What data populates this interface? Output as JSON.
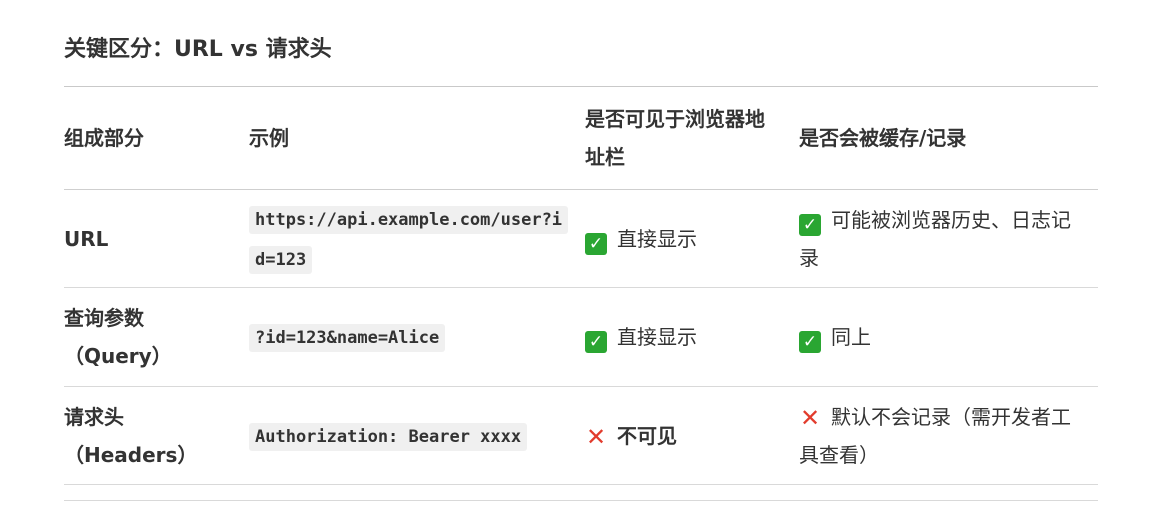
{
  "heading": "关键区分：URL vs 请求头",
  "columns": [
    "组成部分",
    "示例",
    "是否可见于浏览器地址栏",
    "是否会被缓存/记录"
  ],
  "rows": [
    {
      "part": "URL",
      "example": "https://api.example.com/user?id=123",
      "visible": {
        "icon": "check-icon",
        "text": "直接显示"
      },
      "cached": {
        "icon": "check-icon",
        "text": "可能被浏览器历史、日志记录"
      }
    },
    {
      "part": "查询参数\n（Query）",
      "example": "?id=123&name=Alice",
      "visible": {
        "icon": "check-icon",
        "text": "直接显示"
      },
      "cached": {
        "icon": "check-icon",
        "text": "同上"
      }
    },
    {
      "part": "请求头\n（Headers）",
      "example": "Authorization: Bearer xxxx",
      "visible": {
        "icon": "cross-icon",
        "text": "不可见"
      },
      "cached": {
        "icon": "cross-icon",
        "text": "默认不会记录（需开发者工具查看）"
      }
    }
  ],
  "colors": {
    "check": "#2aa632",
    "cross": "#e23c2d",
    "code_bg": "#f0f0f0",
    "text": "#333333"
  }
}
